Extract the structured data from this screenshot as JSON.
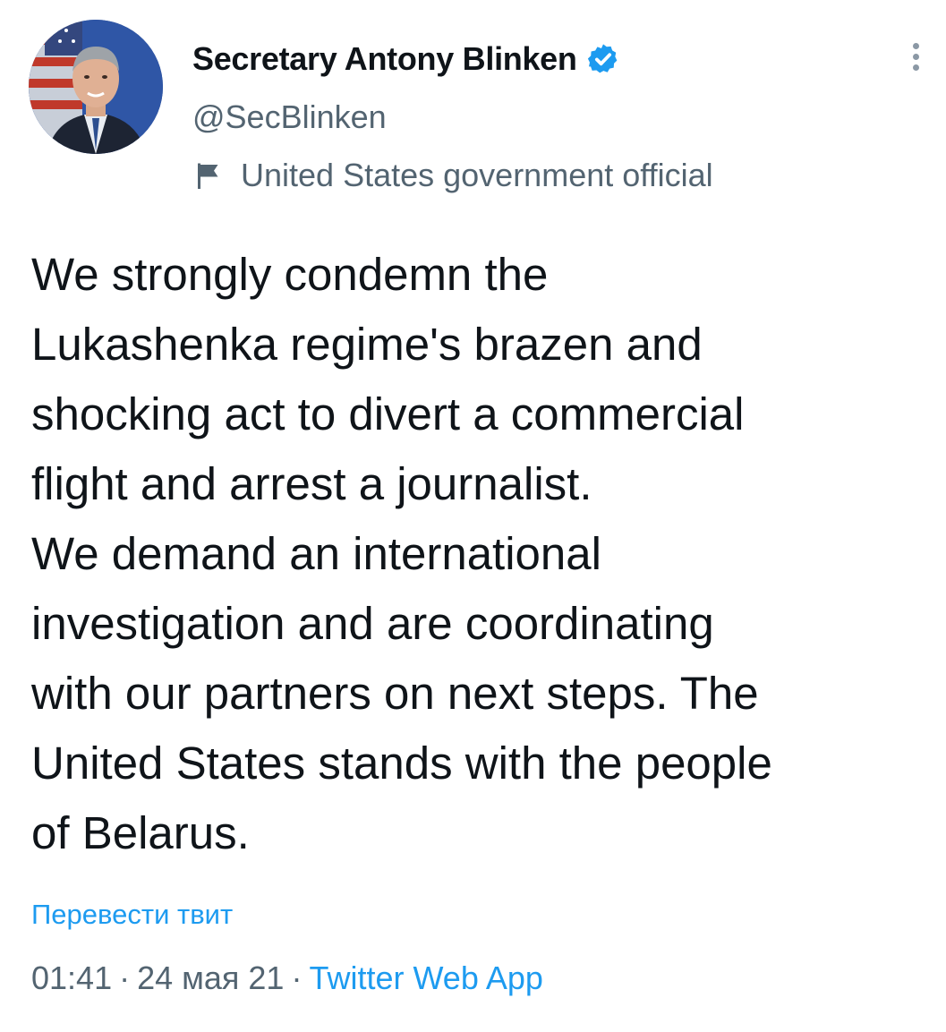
{
  "author": {
    "display_name": "Secretary Antony Blinken",
    "handle": "@SecBlinken",
    "label": "United States government official",
    "verified_icon": "verified-badge-icon",
    "label_icon": "flag-icon"
  },
  "tweet": {
    "text": "We strongly condemn the\nLukashenka regime's brazen and\nshocking act to divert a commercial\nflight and arrest a journalist.\nWe demand an international\ninvestigation and are coordinating\nwith our partners on next steps. The\nUnited States stands with the people\nof Belarus.",
    "translate_label": "Перевести твит",
    "time": "01:41",
    "date": "24 мая 21",
    "separator": "·",
    "source": "Twitter Web App"
  },
  "colors": {
    "accent": "#1d9bf0",
    "text": "#0f1419",
    "secondary": "#536471"
  }
}
